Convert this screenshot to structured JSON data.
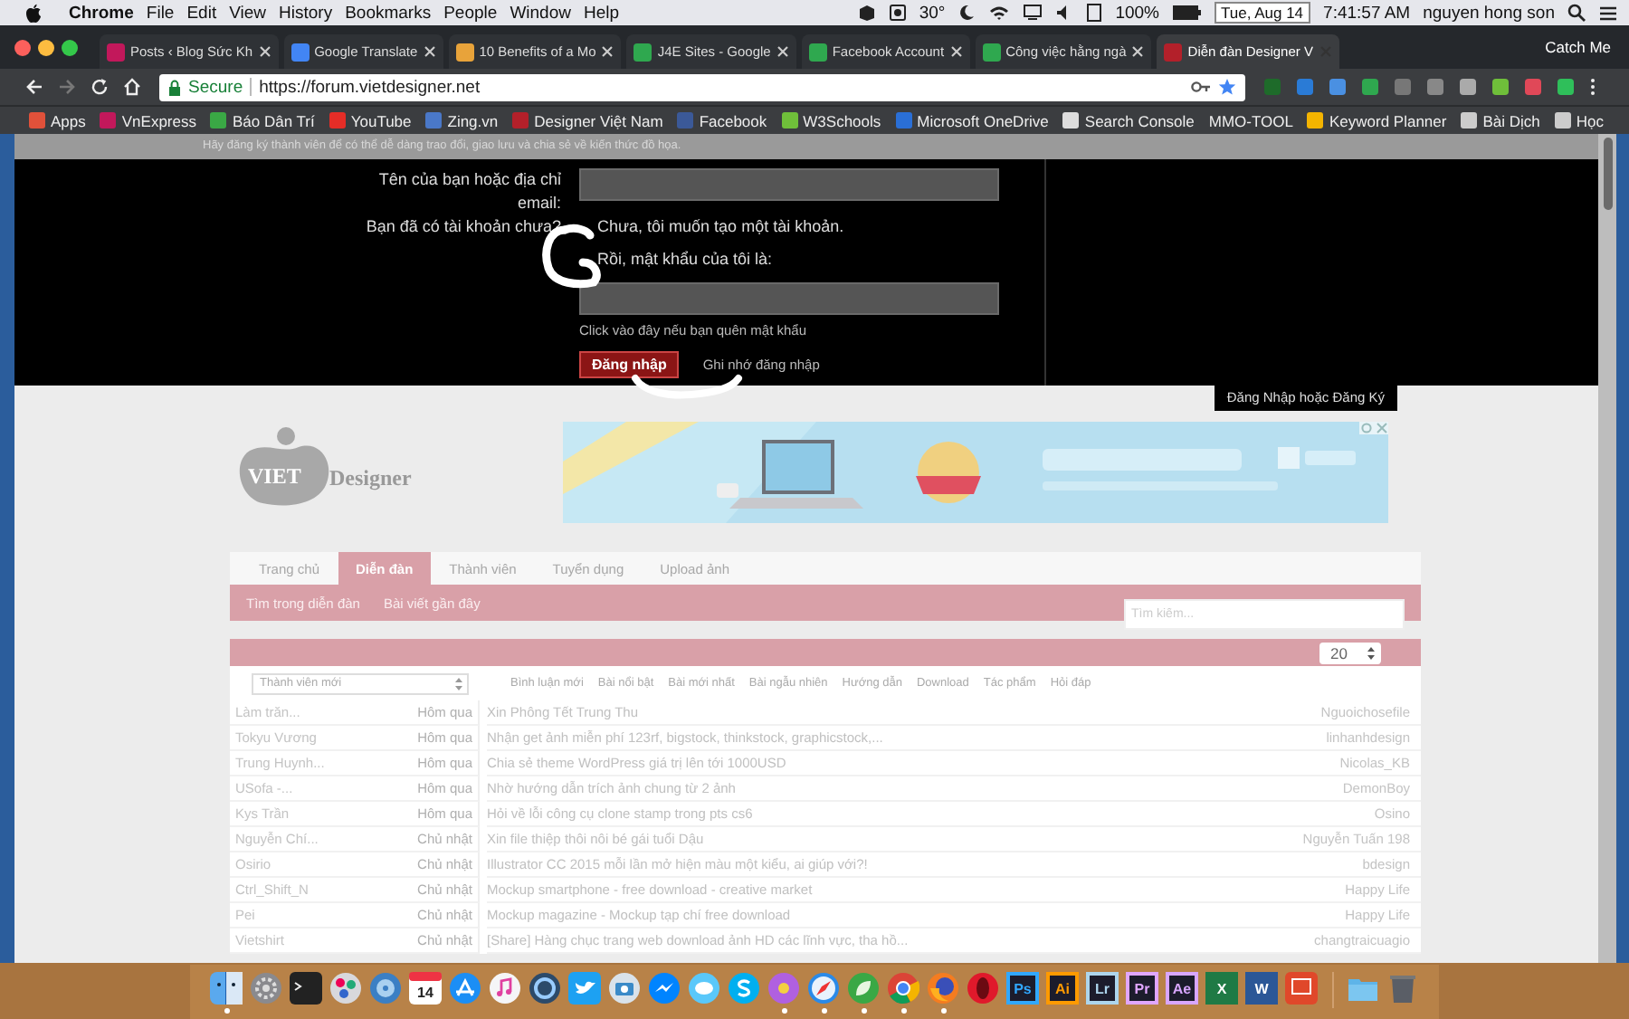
{
  "menubar": {
    "app": "Chrome",
    "menus": [
      "File",
      "Edit",
      "View",
      "History",
      "Bookmarks",
      "People",
      "Window",
      "Help"
    ],
    "temperature": "30°",
    "battery": "100%",
    "date": "Tue, Aug 14",
    "time": "7:41:57 AM",
    "user": "nguyen hong son"
  },
  "tabs": [
    {
      "title": "Posts ‹ Blog Sức Kh",
      "color": "#c2185b",
      "selected": false
    },
    {
      "title": "Google Translate",
      "color": "#4285f4",
      "selected": false
    },
    {
      "title": "10 Benefits of a Mo",
      "color": "#e8a33a",
      "selected": false
    },
    {
      "title": "J4E Sites - Google",
      "color": "#2fa84f",
      "selected": false
    },
    {
      "title": "Facebook Account",
      "color": "#2fa84f",
      "selected": false
    },
    {
      "title": "Công việc hằng ngà",
      "color": "#2fa84f",
      "selected": false
    },
    {
      "title": "Diễn đàn Designer V",
      "color": "#b3202a",
      "selected": true
    }
  ],
  "profile": "Catch Me",
  "address": {
    "secure": "Secure",
    "url": "https://forum.vietdesigner.net"
  },
  "bookmarks": [
    {
      "label": "Apps",
      "color": "#e0513a"
    },
    {
      "label": "VnExpress",
      "color": "#c2185b"
    },
    {
      "label": "Báo Dân Trí",
      "color": "#3aa845"
    },
    {
      "label": "YouTube",
      "color": "#e52d27"
    },
    {
      "label": "Zing.vn",
      "color": "#4a78c8"
    },
    {
      "label": "Designer Việt Nam",
      "color": "#b3202a"
    },
    {
      "label": "Facebook",
      "color": "#3b5998"
    },
    {
      "label": "W3Schools",
      "color": "#6fbf3a"
    },
    {
      "label": "Microsoft OneDrive",
      "color": "#2a6fd6"
    },
    {
      "label": "Search Console",
      "color": "#dddddd"
    },
    {
      "label": "MMO-TOOL"
    },
    {
      "label": "Keyword Planner",
      "color": "#f4b400"
    },
    {
      "label": "Bài Dịch",
      "color": "#cccccc"
    },
    {
      "label": "Học",
      "color": "#cccccc"
    }
  ],
  "notice": "Hãy đăng ký thành viên để có thể dễ dàng trao đổi, giao lưu và chia sẻ về kiến thức đồ họa.",
  "login": {
    "name_label": "Tên của bạn hoặc địa chỉ email:",
    "account_label": "Bạn đã có tài khoản chưa?",
    "option_new": "Chưa, tôi muốn tạo một tài khoản.",
    "option_existing": "Rồi, mật khẩu của tôi là:",
    "forgot": "Click vào đây nếu bạn quên mật khẩu",
    "submit": "Đăng nhập",
    "remember": "Ghi nhớ đăng nhập"
  },
  "login_tab": "Đăng Nhập hoặc Đăng Ký",
  "logo": {
    "mark": "VIET",
    "word": "Designer"
  },
  "nav": {
    "tabs": [
      {
        "label": "Trang chủ",
        "selected": false
      },
      {
        "label": "Diễn đàn",
        "selected": true
      },
      {
        "label": "Thành viên",
        "selected": false
      },
      {
        "label": "Tuyển dụng",
        "selected": false
      },
      {
        "label": "Upload ảnh",
        "selected": false
      }
    ],
    "subnav": [
      "Tìm trong diễn đàn",
      "Bài viết gần đây"
    ],
    "search": {
      "placeholder": "Tìm kiếm..."
    }
  },
  "list": {
    "per_page": "20",
    "member_filter": "Thành viên mới",
    "filters": [
      "Bình luận mới",
      "Bài nổi bật",
      "Bài mới nhất",
      "Bài ngẫu nhiên",
      "Hướng dẫn",
      "Download",
      "Tác phẩm",
      "Hỏi đáp"
    ],
    "rows": [
      {
        "member": "Làm trăn...",
        "time": "Hôm qua",
        "title": "Xin Phông Tết Trung Thu",
        "author": "Nguoichosefile"
      },
      {
        "member": "Tokyu Vương",
        "time": "Hôm qua",
        "title": "Nhận get ảnh miễn phí 123rf, bigstock, thinkstock, graphicstock,...",
        "author": "linhanhdesign"
      },
      {
        "member": "Trung Huynh...",
        "time": "Hôm qua",
        "title": "Chia sẻ theme WordPress giá trị lên tới 1000USD",
        "author": "Nicolas_KB"
      },
      {
        "member": "USofa -...",
        "time": "Hôm qua",
        "title": "Nhờ hướng dẫn trích ảnh chung từ 2 ảnh",
        "author": "DemonBoy"
      },
      {
        "member": "Kys Trần",
        "time": "Hôm qua",
        "title": "Hỏi về lỗi công cụ clone stamp trong pts cs6",
        "author": "Osino"
      },
      {
        "member": "Nguyễn Chí...",
        "time": "Chủ nhật",
        "title": "Xin file thiệp thôi nôi bé gái tuổi Dậu",
        "author": "Nguyễn Tuấn 198"
      },
      {
        "member": "Osirio",
        "time": "Chủ nhật",
        "title": "Illustrator CC 2015 mỗi lần mở hiện màu một kiểu, ai giúp với?!",
        "author": "bdesign"
      },
      {
        "member": "Ctrl_Shift_N",
        "time": "Chủ nhật",
        "title": "Mockup smartphone - free download - creative market",
        "author": "Happy Life"
      },
      {
        "member": "Pei",
        "time": "Chủ nhật",
        "title": "Mockup magazine - Mockup tạp chí free download",
        "author": "Happy Life"
      },
      {
        "member": "Vietshirt",
        "time": "Chủ nhật",
        "title": "[Share] Hàng chục trang web download ảnh HD các lĩnh vực, tha hồ...",
        "author": "changtraicuagio"
      }
    ]
  },
  "dock": [
    {
      "kind": "finder",
      "running": true
    },
    {
      "kind": "gear",
      "running": false
    },
    {
      "kind": "terminal",
      "running": false
    },
    {
      "kind": "film",
      "running": false
    },
    {
      "kind": "disc",
      "running": false
    },
    {
      "kind": "calendar",
      "label": "14",
      "running": false
    },
    {
      "kind": "appstore",
      "running": false
    },
    {
      "kind": "music",
      "running": false
    },
    {
      "kind": "quicktime",
      "running": false
    },
    {
      "kind": "bird",
      "running": false
    },
    {
      "kind": "camera",
      "running": false
    },
    {
      "kind": "messenger",
      "running": false
    },
    {
      "kind": "chat",
      "running": false
    },
    {
      "kind": "skype",
      "running": false
    },
    {
      "kind": "flower",
      "running": true
    },
    {
      "kind": "compass",
      "running": true
    },
    {
      "kind": "leaf",
      "running": true
    },
    {
      "kind": "chrome",
      "running": true
    },
    {
      "kind": "firefox",
      "running": true
    },
    {
      "kind": "opera",
      "running": false
    },
    {
      "kind": "adobe",
      "label": "Ps",
      "color": "#31a8ff",
      "running": false
    },
    {
      "kind": "adobe",
      "label": "Ai",
      "color": "#ff9a00",
      "running": false
    },
    {
      "kind": "adobe",
      "label": "Lr",
      "color": "#add5ec",
      "running": false
    },
    {
      "kind": "adobe",
      "label": "Pr",
      "color": "#e0a6ff",
      "running": false
    },
    {
      "kind": "adobe",
      "label": "Ae",
      "color": "#d8a6ff",
      "running": false
    },
    {
      "kind": "office",
      "label": "X",
      "color": "#1f7a45",
      "running": false
    },
    {
      "kind": "office",
      "label": "W",
      "color": "#2b5797",
      "running": false
    },
    {
      "kind": "slides",
      "running": false
    },
    {
      "kind": "separator"
    },
    {
      "kind": "folder",
      "running": false
    },
    {
      "kind": "trash",
      "running": false
    }
  ]
}
